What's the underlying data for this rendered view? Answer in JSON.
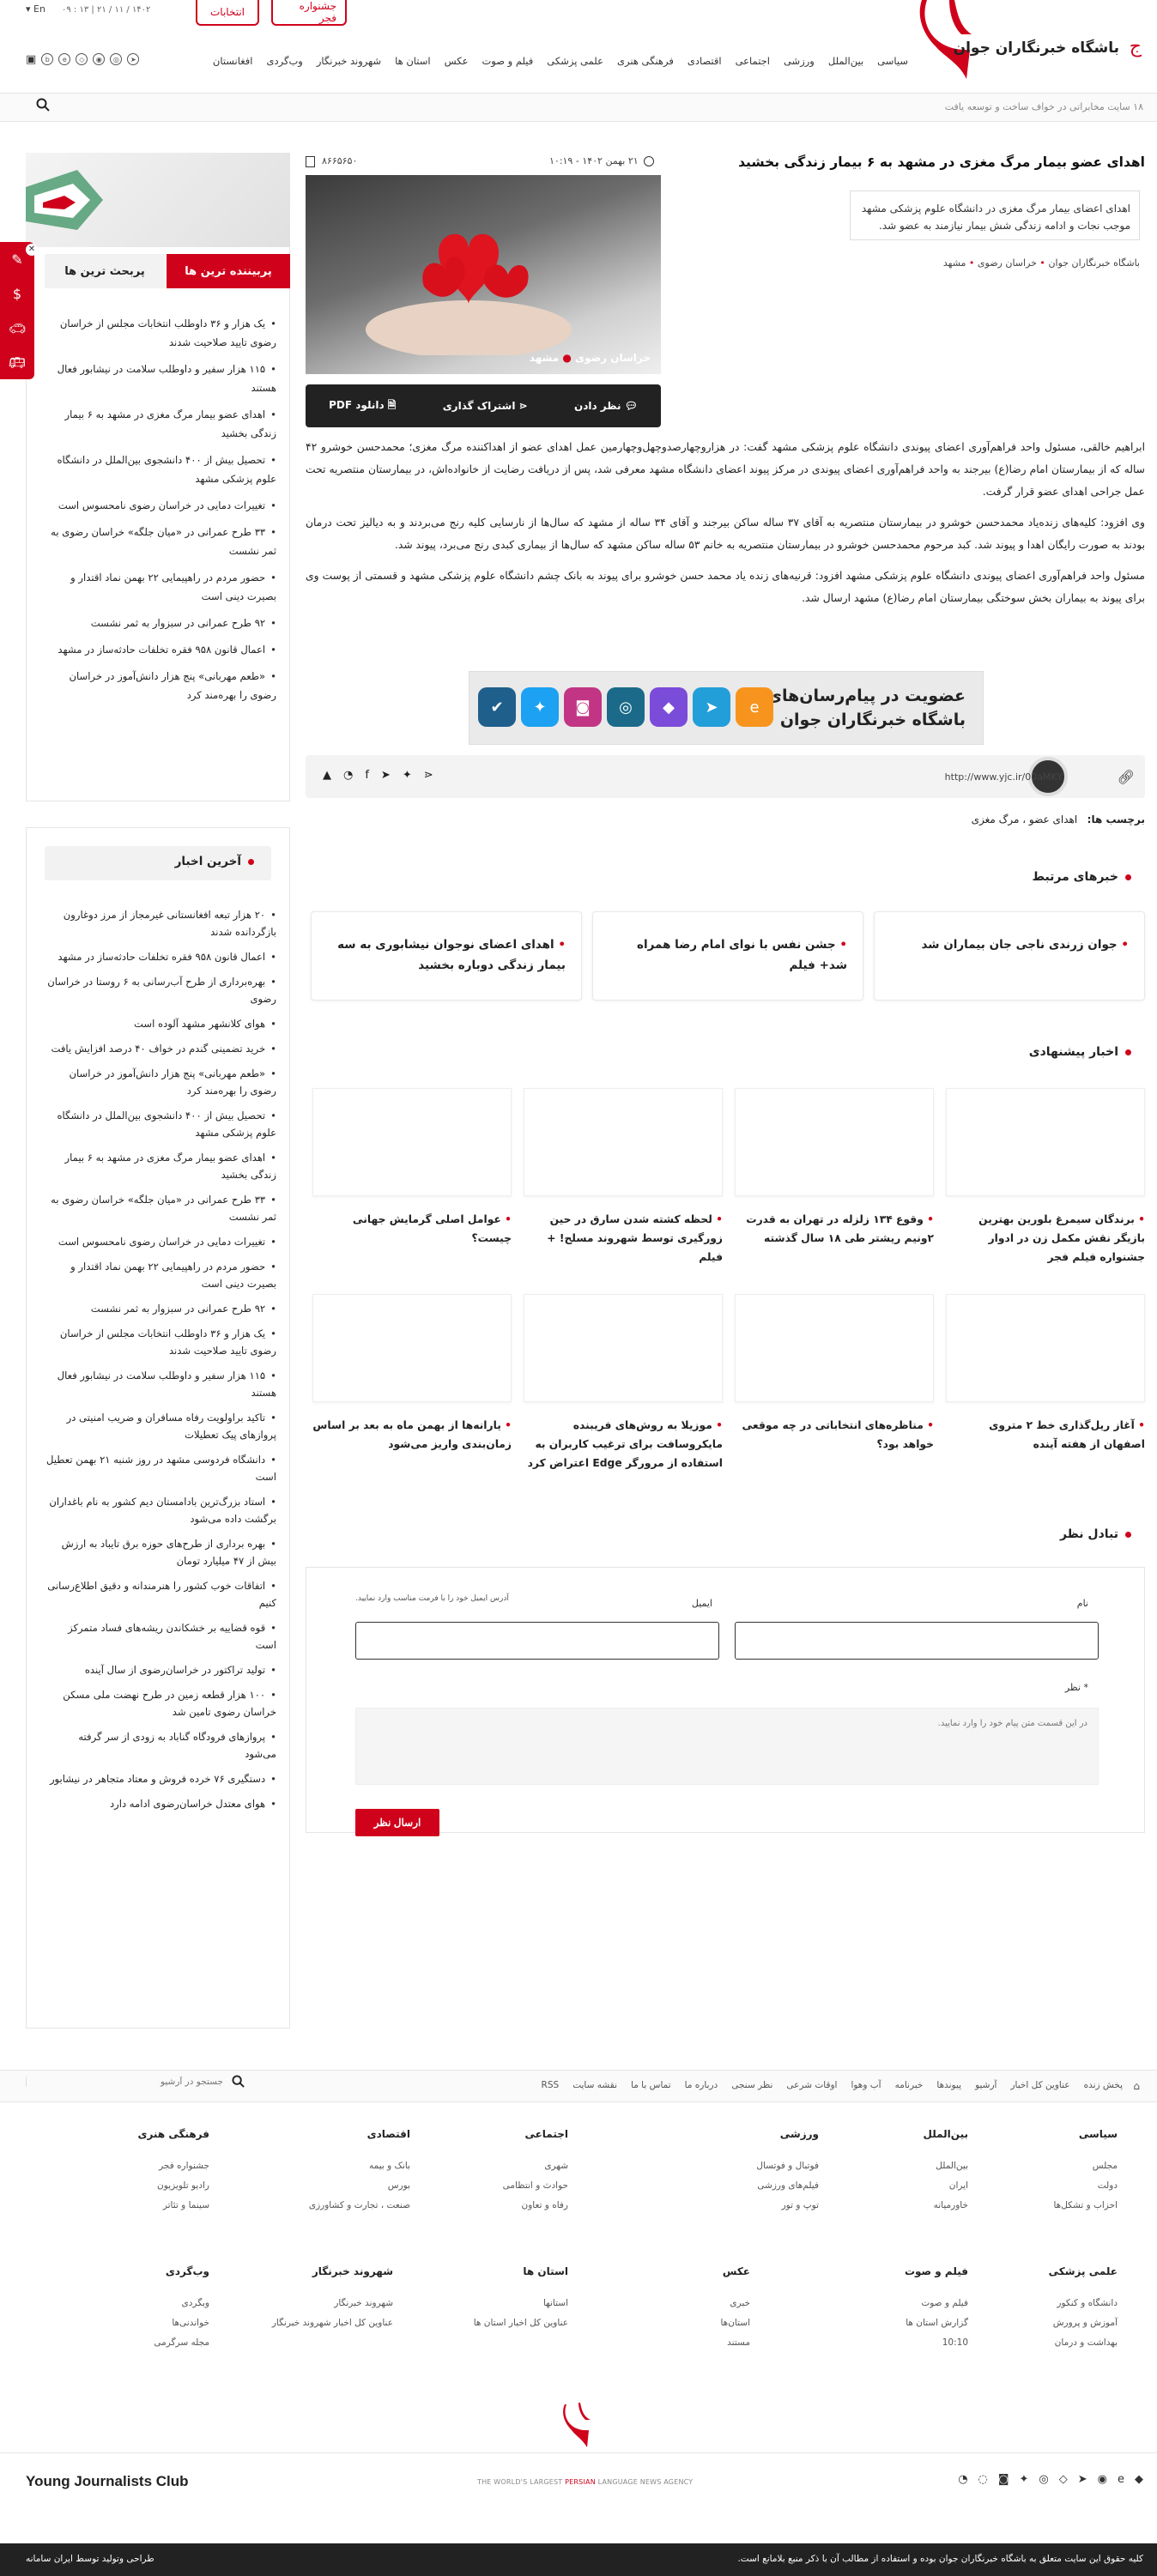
{
  "header": {
    "lang": "En",
    "date": "۱۴۰۲ / ۱۱ / ۲۱  |  ۱۳ : ۰۹",
    "fajr_button": "جشنواره فجر",
    "elections_button": "انتخابات",
    "logo_text": "باشگاه خبرنگاران جوان",
    "nav": [
      "سیاسی",
      "بین‌الملل",
      "ورزشی",
      "اجتماعی",
      "اقتصادی",
      "فرهنگی هنری",
      "علمی پزشکی",
      "فیلم و صوت",
      "عکس",
      "استان ها",
      "شهروند خبرنگار",
      "وب‌گردی",
      "افغانستان"
    ],
    "ticker": "۱۸ سایت مخابراتی در خواف ساخت و توسعه یافت"
  },
  "article": {
    "title": "اهدای عضو بیمار مرگ مغزی در مشهد به ۶ بیمار زندگی بخشید",
    "lead": "اهدای اعضای بیمار مرگ مغزی در دانشگاه علوم پزشکی مشهد موجب نجات و ادامه زندگی شش بیمار نیازمند به عضو شد.",
    "breadcrumb": [
      "باشگاه خبرنگاران جوان",
      "خراسان رضوی",
      "مشهد"
    ],
    "date": "۲۱ بهمن ۱۴۰۲ - ۱۰:۱۹",
    "id": "۸۶۶۵۶۵۰",
    "image_caption_a": "خراسان رضوی",
    "image_caption_b": "مشهد",
    "actions": {
      "comment": "نظر دادن",
      "share": "اشتراک گذاری",
      "pdf": "دانلود PDF"
    },
    "paragraphs": [
      "ابراهیم خالقی، مسئول واحد فراهم‌آوری اعضای پیوندی دانشگاه علوم پزشکی مشهد گفت: در هزاروچهارصدوچهل‌وچهارمین عمل اهدای عضو از اهداکننده مرگ مغزی؛ محمدحسن خوشرو ۴۲ ساله که از بیمارستان امام رضا(ع) بیرجند به واحد فراهم‌آوری اعضای پیوندی در مرکز پیوند اعضای دانشگاه مشهد معرفی شد، پس از دریافت رضایت از خانواده‌اش، در بیمارستان منتصریه تحت عمل جراحی اهدای عضو قرار گرفت.",
      "وی افزود: کلیه‌های زنده‌یاد محمدحسن خوشرو در بیمارستان منتصریه به آقای ۳۷ ساله ساکن بیرجند و آقای ۳۴ ساله از مشهد که سال‌ها از نارسایی کلیه رنج می‌بردند و به دیالیز تحت درمان بودند به صورت رایگان اهدا و پیوند شد. کبد مرحوم محمدحسن خوشرو در بیمارستان منتصریه به خانم ۵۳ ساله ساکن مشهد که سال‌ها از بیماری کبدی رنج می‌برد، پیوند شد.",
      "مسئول واحد فراهم‌آوری اعضای پیوندی دانشگاه علوم پزشکی مشهد افزود: قرنیه‌های زنده یاد محمد حسن خوشرو برای پیوند به بانک چشم دانشگاه علوم پزشکی مشهد و قسمتی از پوست وی برای پیوند به بیماران بخش سوختگی بیمارستان امام رضا(ع) مشهد ارسال شد."
    ],
    "banner_line1": "عضویت در پیام‌رسان‌های",
    "banner_line2": "باشگاه خبرنگاران جوان",
    "short_url": "http://www.yjc.ir/00aMKY",
    "tags_label": "برچسب ها:",
    "tags": "اهدای عضو ، مرگ مغزی"
  },
  "related": {
    "heading": "خبرهای مرتبط",
    "items": [
      "جوان زرندی ناجی جان بیماران شد",
      "جشن نفس با نوای امام رضا همراه شد+ فیلم",
      "اهدای اعضای نوجوان نیشابوری به سه بیمار زندگی دوباره بخشید"
    ]
  },
  "suggested": {
    "heading": "اخبار پیشنهادی",
    "row1": [
      "برندگان سیمرغ بلورین بهترین بازیگر نقش مکمل زن در ادوار جشنواره فیلم فجر",
      "وقوع ۱۳۴ زلزله در تهران به قدرت ۲ونیم ریشتر طی ۱۸ سال گذشته",
      "لحظه کشته شدن سارق در حین زورگیری توسط شهروند مسلح! + فیلم",
      "عوامل اصلی گرمایش جهانی چیست؟"
    ],
    "row2": [
      "آغاز ریل‌گذاری خط ۲ متروی اصفهان از هفته آینده",
      "مناظره‌های انتخاباتی در چه موقعی خواهد بود؟",
      "موزیلا به روش‌های فریبنده مایکروسافت برای ترغیب کاربران به استفاده از مرورگر Edge اعتراض کرد",
      "یارانه‌ها از بهمن ماه به بعد بر اساس زمان‌بندی واریز می‌شود"
    ]
  },
  "comment_form": {
    "heading": "تبادل نظر",
    "name_label": "نام",
    "email_label": "ایمیل",
    "email_hint": "آدرس ایمیل خود را با فرمت مناسب وارد نمایید.",
    "comment_label": "* نظر",
    "comment_placeholder": "در این قسمت متن پیام خود را وارد نمایید.",
    "submit": "ارسال نظر"
  },
  "sidebar": {
    "tab_most_read": "پربیننده ترین ها",
    "tab_popular": "پربحث ترین ها",
    "most_read": [
      "یک هزار و ۳۶ داوطلب انتخابات مجلس از خراسان رضوی تایید صلاحیت شدند",
      "۱۱۵ هزار سفیر و داوطلب سلامت در نیشابور فعال هستند",
      "اهدای عضو بیمار مرگ مغزی در مشهد به ۶ بیمار زندگی بخشید",
      "تحصیل بیش از ۴۰۰ دانشجوی بین‌الملل در دانشگاه علوم پزشکی مشهد",
      "تغییرات دمایی در خراسان رضوی نامحسوس است",
      "۳۳ طرح عمرانی در «میان جلگه» خراسان رضوی به ثمر نشست",
      "حضور مردم در راهپیمایی ۲۲ بهمن نماد اقتدار و بصیرت دینی است",
      "۹۲ طرح عمرانی در سبزوار به ثمر نشست",
      "اعمال قانون ۹۵۸ فقره تخلفات حادثه‌ساز در مشهد",
      "«طعم مهربانی» پنج هزار دانش‌آموز در خراسان رضوی را بهره‌مند کرد"
    ],
    "latest_heading": "آخرین اخبار",
    "latest": [
      "۲۰ هزار تبعه افغانستانی غیرمجاز از مرز دوغارون بازگردانده شدند",
      "اعمال قانون ۹۵۸ فقره تخلفات حادثه‌ساز در مشهد",
      "بهره‌برداری از طرح آب‌رسانی به ۶ روستا در خراسان رضوی",
      "هوای کلانشهر مشهد آلوده است",
      "خرید تضمینی گندم در خواف ۴۰ درصد افزایش یافت",
      "«طعم مهربانی» پنج هزار دانش‌آموز در خراسان رضوی را بهره‌مند کرد",
      "تحصیل بیش از ۴۰۰ دانشجوی بین‌الملل در دانشگاه علوم پزشکی مشهد",
      "اهدای عضو بیمار مرگ مغزی در مشهد به ۶ بیمار زندگی بخشید",
      "۳۳ طرح عمرانی در «میان جلگه» خراسان رضوی به ثمر نشست",
      "تغییرات دمایی در خراسان رضوی نامحسوس است",
      "حضور مردم در راهپیمایی ۲۲ بهمن نماد اقتدار و بصیرت دینی است",
      "۹۲ طرح عمرانی در سبزوار به ثمر نشست",
      "یک هزار و ۳۶ داوطلب انتخابات مجلس از خراسان رضوی تایید صلاحیت شدند",
      "۱۱۵ هزار سفیر و داوطلب سلامت در نیشابور فعال هستند",
      "تاکید براولویت رفاه مسافران و ضریب امنیتی در پروازهای پیک تعطیلات",
      "دانشگاه فردوسی مشهد در روز شنبه ۲۱ بهمن تعطیل است",
      "استاد بزرگ‌ترین بادامستان دیم کشور به نام باغداران برگشت داده می‌شود",
      "بهره برداری از طرح‌های حوزه برق تایباد به ارزش بیش از ۴۷ میلیارد تومان",
      "اتفاقات خوب کشور را هنرمندانه و دقیق اطلاع‌رسانی کنیم",
      "قوه قضاییه بر خشکاندن ریشه‌های فساد متمرکز است",
      "تولید تراکتور در خراسان‌رضوی از سال آینده",
      "۱۰۰ هزار قطعه زمین در طرح نهضت ملی مسکن خراسان رضوی تامین شد",
      "پروازهای فرودگاه گناباد به زودی از سر گرفته می‌شود",
      "دستگیری ۷۶ خرده فروش و معتاد متجاهر در نیشابور",
      "هوای معتدل خراسان‌رضوی ادامه دارد"
    ]
  },
  "footer": {
    "links": [
      "پخش زنده",
      "عناوین کل اخبار",
      "آرشیو",
      "پیوندها",
      "خبرنامه",
      "آب وهوا",
      "اوقات شرعی",
      "نظر سنجی",
      "درباره ما",
      "تماس با ما",
      "نقشه سایت",
      "RSS"
    ],
    "search_placeholder": "جستجو در آرشیو",
    "columns": [
      {
        "title": "سیاسی",
        "items": [
          "مجلس",
          "دولت",
          "احزاب و تشکل‌ها"
        ]
      },
      {
        "title": "بین‌الملل",
        "items": [
          "بین‌الملل",
          "ایران",
          "خاورمیانه"
        ]
      },
      {
        "title": "ورزشی",
        "items": [
          "فوتبال و فوتسال",
          "فیلم‌های ورزشی",
          "توپ و تور"
        ]
      },
      {
        "title": "اجتماعی",
        "items": [
          "شهری",
          "حوادث و انتظامی",
          "رفاه و تعاون"
        ]
      },
      {
        "title": "اقتصادی",
        "items": [
          "بانک و بیمه",
          "بورس",
          "صنعت ، تجارت و کشاورزی"
        ]
      },
      {
        "title": "فرهنگی هنری",
        "items": [
          "جشنواره فجر",
          "رادیو تلویزیون",
          "سینما و تئاتر"
        ]
      },
      {
        "title": "علمی پزشکی",
        "items": [
          "دانشگاه و کنکور",
          "آموزش و پرورش",
          "بهداشت و درمان"
        ]
      },
      {
        "title": "فیلم و صوت",
        "items": [
          "فیلم و صوت",
          "گزارش استان ها",
          "10:10"
        ]
      },
      {
        "title": "عکس",
        "items": [
          "خبری",
          "استان‌ها",
          "مستند"
        ]
      },
      {
        "title": "استان ها",
        "items": [
          "استانها",
          "عناوین کل اخبار استان ها"
        ]
      },
      {
        "title": "شهروند خبرنگار",
        "items": [
          "شهروند خبرنگار",
          "عناوین کل اخبار شهروند خبرنگار"
        ]
      },
      {
        "title": "وب‌گردی",
        "items": [
          "وبگردی",
          "خواندنی‌ها",
          "مجله سرگرمی"
        ]
      }
    ],
    "brand_en": "Young Journalists Club",
    "tagline_a": "THE WORLD'S LARGEST ",
    "tagline_b": "PERSIAN",
    "tagline_c": " LANGUAGE NEWS AGENCY",
    "copyright": "کلیه حقوق این سایت متعلق به باشگاه خبرنگاران جوان بوده و استفاده از مطالب آن با ذکر منبع بلامانع است.",
    "design_credit": "طراحی وتولید توسط ایران سامانه"
  },
  "colors": {
    "accent": "#d0021b",
    "dark": "#222222"
  }
}
